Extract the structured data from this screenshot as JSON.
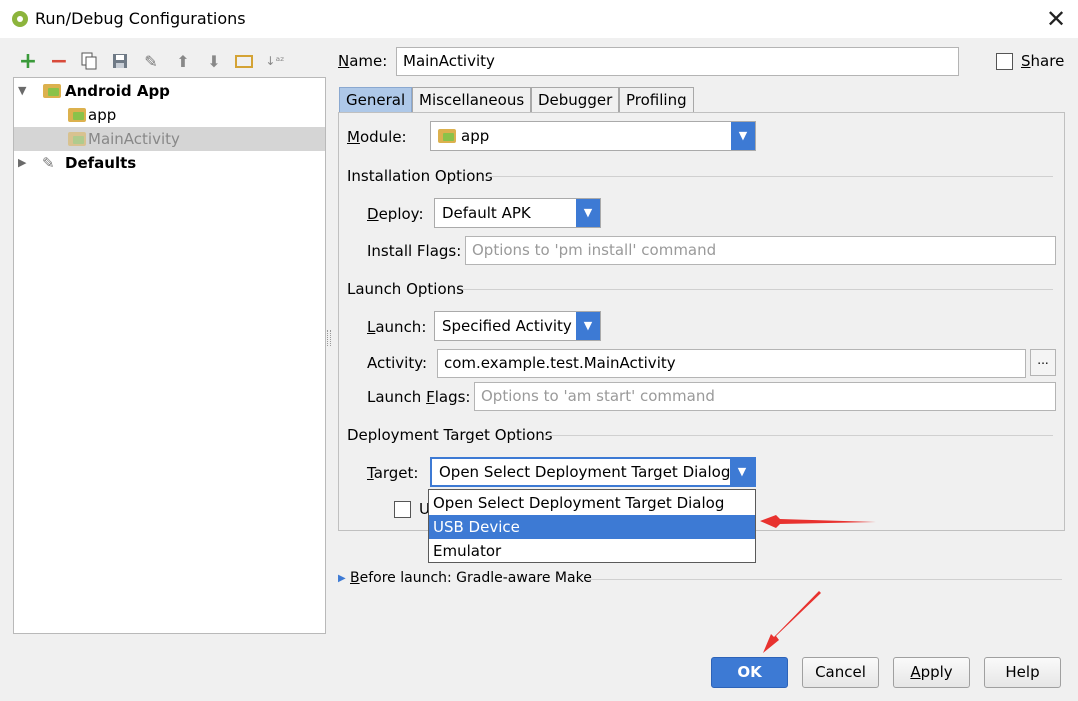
{
  "window": {
    "title": "Run/Debug Configurations",
    "close_glyph": "✕"
  },
  "toolbar": {
    "icons": [
      "plus-icon",
      "minus-icon",
      "copy-icon",
      "save-icon",
      "wrench-icon",
      "arrow-up-icon",
      "arrow-down-icon",
      "folder-icon",
      "sort-icon"
    ]
  },
  "tree": {
    "items": [
      {
        "label": "Android App",
        "bold": true
      },
      {
        "label": "app"
      },
      {
        "label": "MainActivity",
        "selected": true
      },
      {
        "label": "Defaults",
        "bold": true
      }
    ]
  },
  "name": {
    "label_u": "N",
    "label_rest": "ame:",
    "value": "MainActivity"
  },
  "share": {
    "label_u": "S",
    "label_rest": "hare",
    "checked": false
  },
  "tabs": [
    {
      "label": "General",
      "active": true
    },
    {
      "label": "Miscellaneous"
    },
    {
      "label": "Debugger"
    },
    {
      "label": "Profiling"
    }
  ],
  "module": {
    "label_u": "M",
    "label_rest": "odule:",
    "value": "app"
  },
  "installation": {
    "header": "Installation Options",
    "deploy_label_u": "D",
    "deploy_label_rest": "eploy:",
    "deploy_value": "Default APK",
    "flags_label": "Install Flags:",
    "flags_placeholder": "Options to 'pm install' command"
  },
  "launch": {
    "header": "Launch Options",
    "launch_label_u": "L",
    "launch_label_rest": "aunch:",
    "launch_value": "Specified Activity",
    "activity_label": "Activity:",
    "activity_value": "com.example.test.MainActivity",
    "browse": "...",
    "flags_label_a": "Launch ",
    "flags_label_u": "F",
    "flags_label_b": "lags:",
    "flags_placeholder": "Options to 'am start' command"
  },
  "deployment": {
    "header": "Deployment Target Options",
    "target_label_u": "T",
    "target_label_rest": "arget:",
    "target_value": "Open Select Deployment Target Dialog",
    "hidden_checkbox_letter": "U",
    "options": [
      "Open Select Deployment Target Dialog",
      "USB Device",
      "Emulator"
    ],
    "highlighted_index": 1
  },
  "before_launch": {
    "label_u": "B",
    "label_rest": "efore launch: Gradle-aware Make"
  },
  "buttons": {
    "ok": "OK",
    "cancel": "Cancel",
    "apply_u": "A",
    "apply_rest": "pply",
    "help": "Help"
  },
  "colors": {
    "accent": "#3d7ad4",
    "annotation_arrow": "#e8322f"
  }
}
